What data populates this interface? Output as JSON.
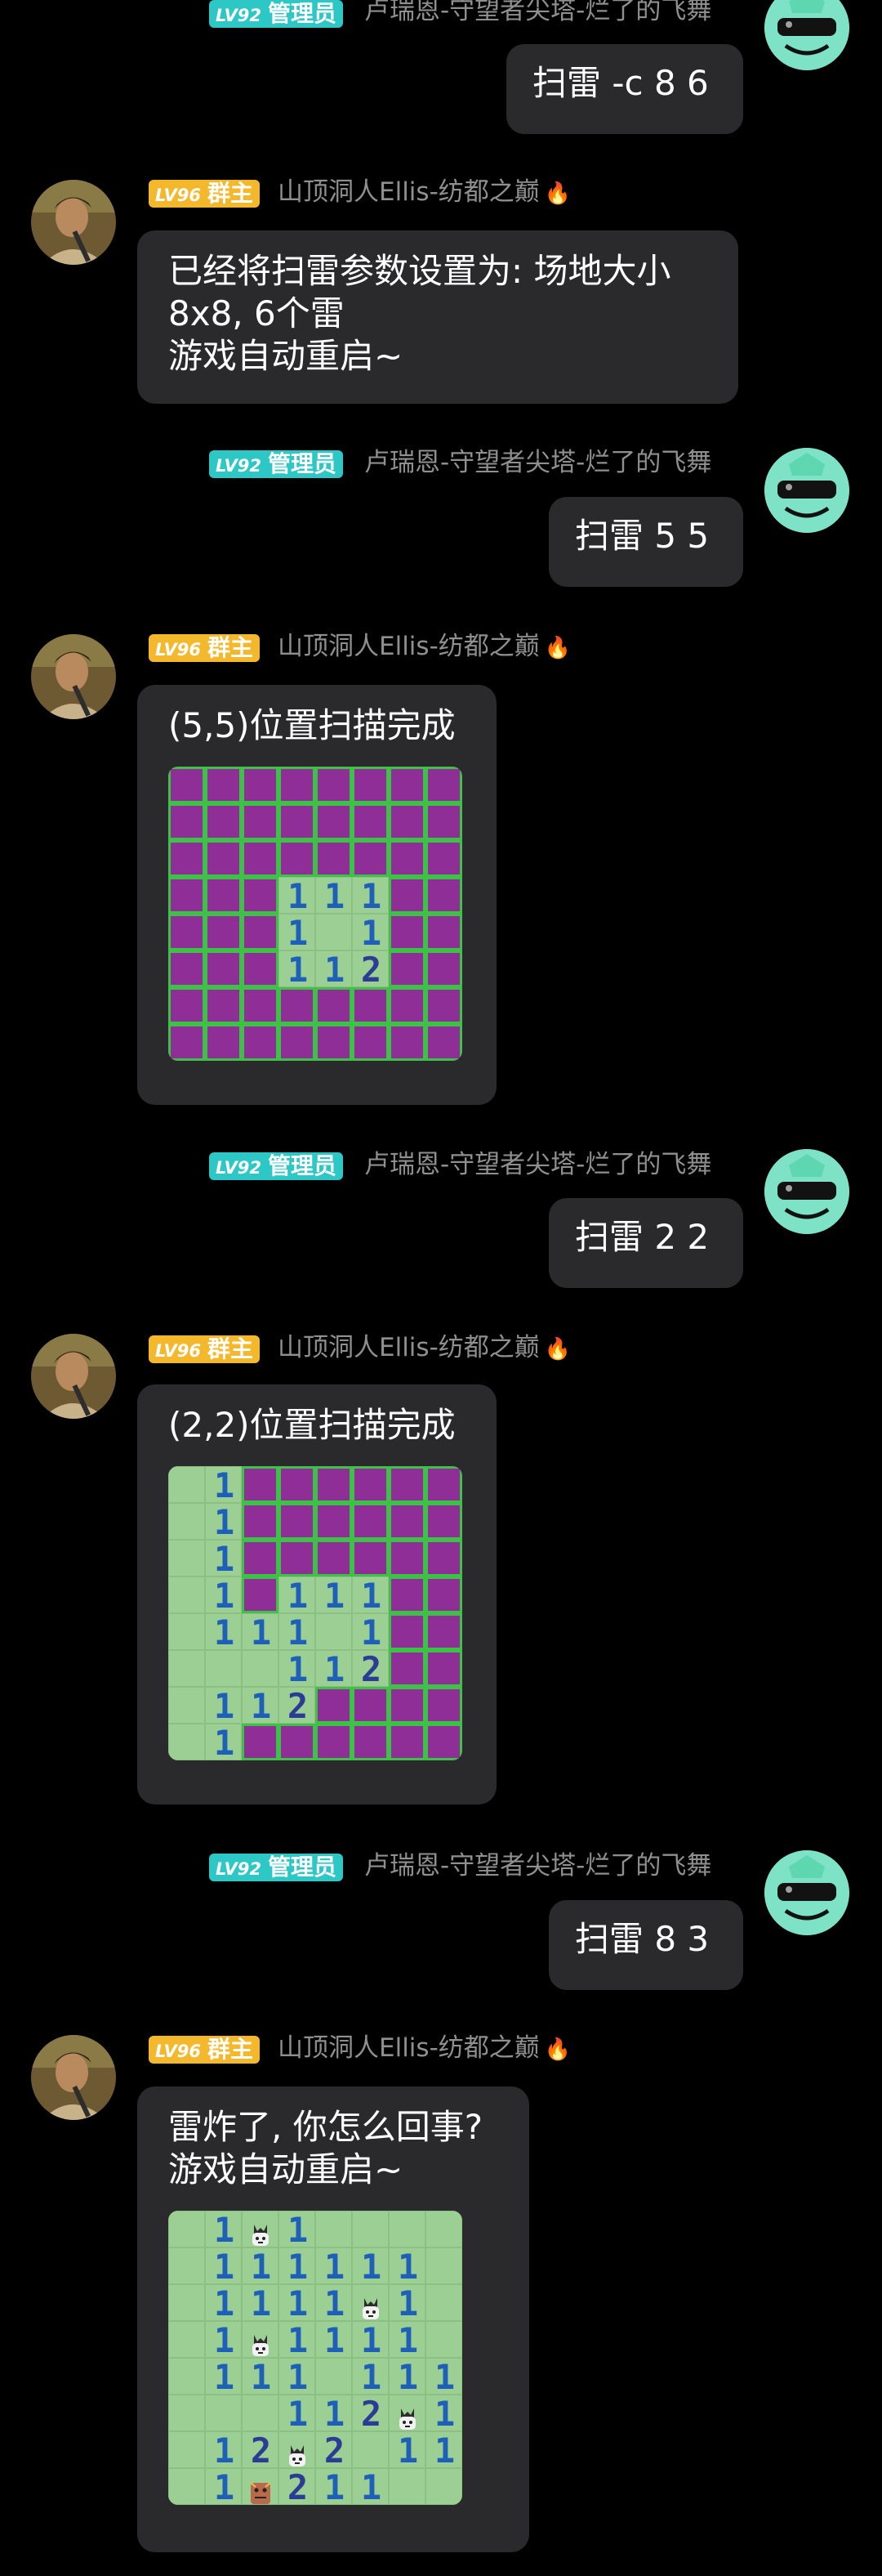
{
  "messages": [
    {
      "kind": "right",
      "level": "LV92",
      "role": "管理员",
      "nick": "卢瑞恩-守望者尖塔-烂了的飞舞",
      "text": "扫雷 -c 8 6"
    },
    {
      "kind": "left",
      "level": "LV96",
      "role": "群主",
      "nick": "山顶洞人Ellis-纺都之巅",
      "text": "已经将扫雷参数设置为: 场地大小\n8x8, 6个雷\n游戏自动重启~"
    },
    {
      "kind": "right",
      "level": "LV92",
      "role": "管理员",
      "nick": "卢瑞恩-守望者尖塔-烂了的飞舞",
      "text": "扫雷 5 5"
    },
    {
      "kind": "left",
      "level": "LV96",
      "role": "群主",
      "nick": "山顶洞人Ellis-纺都之巅",
      "text": "(5,5)位置扫描完成",
      "board": [
        "hhhhhhhh",
        "hhhhhhhh",
        "hhhhhhhh",
        "hhh111hh",
        "hhh1 1hh",
        "hhh112hh",
        "hhhhhhhh",
        "hhhhhhhh"
      ]
    },
    {
      "kind": "right",
      "level": "LV92",
      "role": "管理员",
      "nick": "卢瑞恩-守望者尖塔-烂了的飞舞",
      "text": "扫雷 2 2"
    },
    {
      "kind": "left",
      "level": "LV96",
      "role": "群主",
      "nick": "山顶洞人Ellis-纺都之巅",
      "text": "(2,2)位置扫描完成",
      "board": [
        " 1hhhhhh",
        " 1hhhhhh",
        " 1hhhhhh",
        " 1h111hh",
        " 111 1hh",
        "   112hh",
        " 112hhhh",
        " 1hhhhhh"
      ]
    },
    {
      "kind": "right",
      "level": "LV92",
      "role": "管理员",
      "nick": "卢瑞恩-守望者尖塔-烂了的飞舞",
      "text": "扫雷 8 3"
    },
    {
      "kind": "left",
      "level": "LV96",
      "role": "群主",
      "nick": "山顶洞人Ellis-纺都之巅",
      "text": "雷炸了, 你怎么回事?\n游戏自动重启~",
      "board": [
        " 1M1    ",
        " 111111 ",
        " 1111M1 ",
        " 1M1111 ",
        " 111 111",
        "   112M1",
        " 12M2 11",
        " 1X211  "
      ]
    }
  ]
}
